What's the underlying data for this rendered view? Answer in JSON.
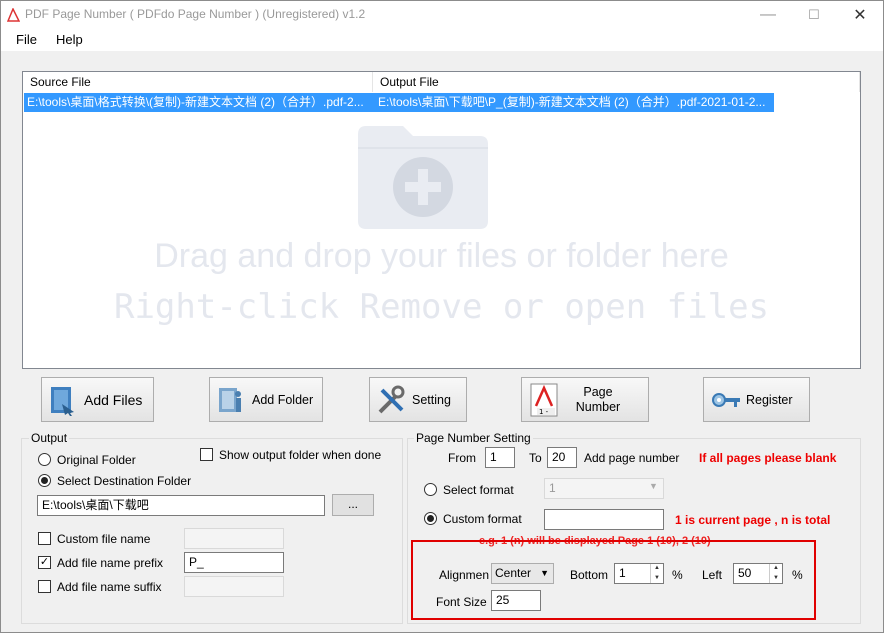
{
  "window": {
    "title": "PDF Page Number ( PDFdo Page Number ) (Unregistered) v1.2",
    "min": "—",
    "max": "☐",
    "close": "✕"
  },
  "menu": {
    "file": "File",
    "help": "Help"
  },
  "filelist": {
    "col_source": "Source File",
    "col_output": "Output File",
    "rows": [
      {
        "source": "E:\\tools\\桌面\\格式转换\\(复制)-新建文本文档 (2)（合并）.pdf-2...",
        "output": "E:\\tools\\桌面\\下载吧\\P_(复制)-新建文本文档 (2)（合并）.pdf-2021-01-2..."
      }
    ],
    "drop_hint_1": "Drag and drop your files or folder here",
    "drop_hint_2": "Right-click Remove or open files"
  },
  "toolbar": {
    "add_files": "Add Files",
    "add_folder": "Add Folder",
    "setting": "Setting",
    "page_number": "Page Number",
    "register": "Register"
  },
  "output": {
    "label": "Output",
    "original_folder": "Original Folder",
    "select_dest": "Select Destination Folder",
    "show_when_done": "Show output folder when done",
    "dest_path": "E:\\tools\\桌面\\下载吧",
    "browse": "...",
    "custom_name": "Custom file name",
    "add_prefix": "Add file name prefix",
    "prefix_value": "P_",
    "add_suffix": "Add file name suffix",
    "custom_checked": false,
    "prefix_checked": true,
    "suffix_checked": false,
    "show_checked": false
  },
  "pns": {
    "label": "Page Number Setting",
    "from_label": "From",
    "from_value": "1",
    "to_label": "To",
    "to_value": "20",
    "add_label": "Add page number",
    "blank_hint": "If all pages please blank",
    "select_format": "Select format",
    "format_value": "1",
    "custom_format": "Custom format",
    "custom_value": "",
    "current_hint": "1 is current page , n is total",
    "example_hint": "e.g.  1 (n) will be displayed Page 1 (10), 2 (10)",
    "align_label": "Alignmen",
    "align_value": "Center",
    "bottom_label": "Bottom",
    "bottom_value": "1",
    "pct1": "%",
    "left_label": "Left",
    "left_value": "50",
    "pct2": "%",
    "fontsize_label": "Font Size",
    "fontsize_value": "25"
  },
  "colors": {
    "selection": "#3399ff",
    "highlight_box": "#e00000",
    "hint_red": "#e00000"
  }
}
